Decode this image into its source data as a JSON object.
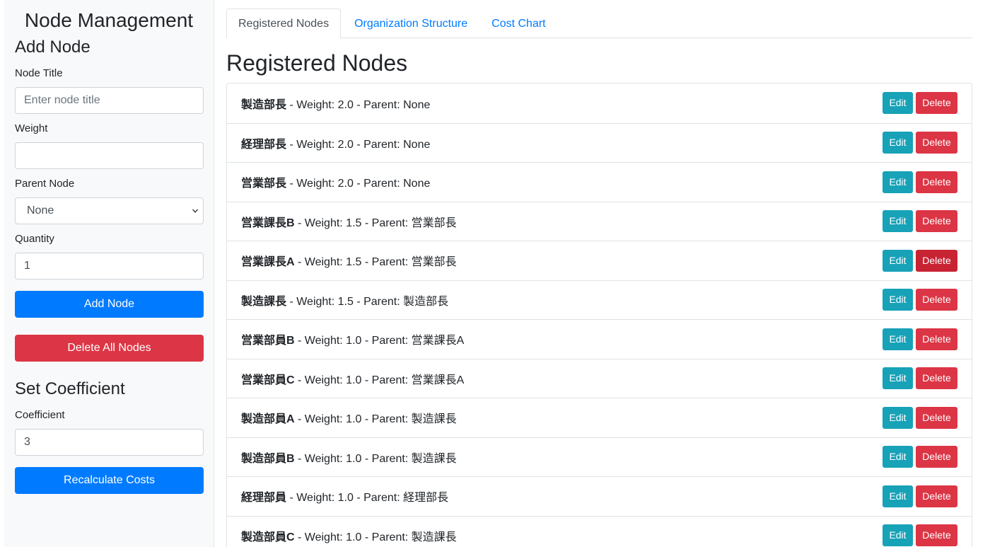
{
  "sidebar": {
    "title": "Node Management",
    "add_heading": "Add Node",
    "node_title_label": "Node Title",
    "node_title_placeholder": "Enter node title",
    "node_title_value": "",
    "weight_label": "Weight",
    "weight_value": "",
    "parent_label": "Parent Node",
    "parent_selected": "None",
    "quantity_label": "Quantity",
    "quantity_value": "1",
    "add_button": "Add Node",
    "delete_all_button": "Delete All Nodes",
    "coef_heading": "Set Coefficient",
    "coef_label": "Coefficient",
    "coef_value": "3",
    "recalc_button": "Recalculate Costs"
  },
  "tabs": [
    {
      "label": "Registered Nodes",
      "active": true
    },
    {
      "label": "Organization Structure",
      "active": false
    },
    {
      "label": "Cost Chart",
      "active": false
    }
  ],
  "main_title": "Registered Nodes",
  "edit_label": "Edit",
  "delete_label": "Delete",
  "nodes": [
    {
      "name": "製造部長",
      "details": " - Weight: 2.0 - Parent: None"
    },
    {
      "name": "経理部長",
      "details": " - Weight: 2.0 - Parent: None"
    },
    {
      "name": "営業部長",
      "details": " - Weight: 2.0 - Parent: None"
    },
    {
      "name": "営業課長B",
      "details": " - Weight: 1.5 - Parent: 営業部長"
    },
    {
      "name": "営業課長A",
      "details": " - Weight: 1.5 - Parent: 営業部長"
    },
    {
      "name": "製造課長",
      "details": " - Weight: 1.5 - Parent: 製造部長"
    },
    {
      "name": "営業部員B",
      "details": " - Weight: 1.0 - Parent: 営業課長A"
    },
    {
      "name": "営業部員C",
      "details": " - Weight: 1.0 - Parent: 営業課長A"
    },
    {
      "name": "製造部員A",
      "details": " - Weight: 1.0 - Parent: 製造課長"
    },
    {
      "name": "製造部員B",
      "details": " - Weight: 1.0 - Parent: 製造課長"
    },
    {
      "name": "経理部員",
      "details": " - Weight: 1.0 - Parent: 経理部長"
    },
    {
      "name": "製造部員C",
      "details": " - Weight: 1.0 - Parent: 製造課長"
    }
  ],
  "colors": {
    "primary": "#007bff",
    "danger": "#dc3545",
    "info": "#17a2b8"
  }
}
